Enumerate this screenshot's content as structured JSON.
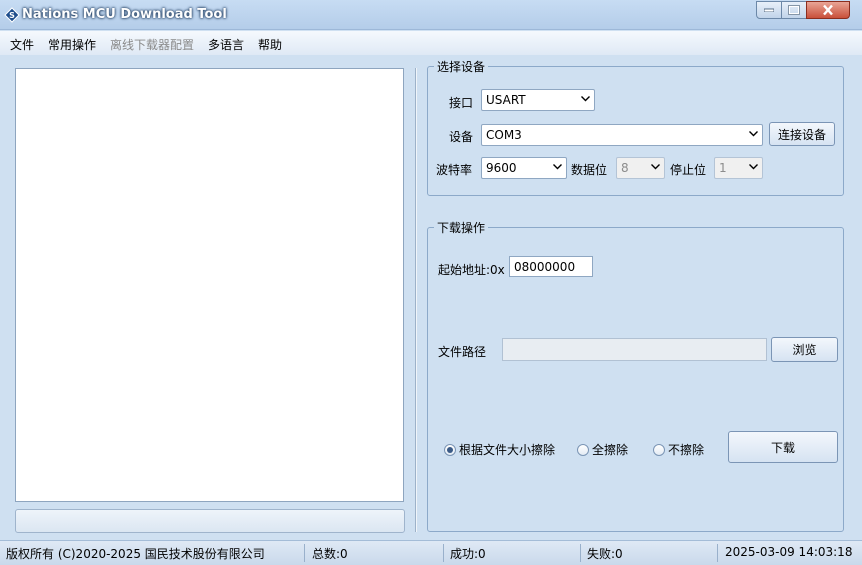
{
  "window": {
    "title": "Nations MCU Download Tool"
  },
  "menu": {
    "items": [
      {
        "label": "文件",
        "disabled": false
      },
      {
        "label": "常用操作",
        "disabled": false
      },
      {
        "label": "离线下载器配置",
        "disabled": true
      },
      {
        "label": "多语言",
        "disabled": false
      },
      {
        "label": "帮助",
        "disabled": false
      }
    ]
  },
  "device_group": {
    "title": "选择设备",
    "interface_label": "接口",
    "interface_value": "USART",
    "device_label": "设备",
    "device_value": "COM3",
    "connect_button": "连接设备",
    "baud_label": "波特率",
    "baud_value": "9600",
    "databits_label": "数据位",
    "databits_value": "8",
    "stopbits_label": "停止位",
    "stopbits_value": "1"
  },
  "download_group": {
    "title": "下载操作",
    "start_addr_label": "起始地址:0x",
    "start_addr_value": "08000000",
    "file_path_label": "文件路径",
    "file_path_value": "",
    "browse_button": "浏览",
    "erase_options": [
      {
        "label": "根据文件大小擦除",
        "checked": true
      },
      {
        "label": "全擦除",
        "checked": false
      },
      {
        "label": "不擦除",
        "checked": false
      }
    ],
    "download_button": "下载"
  },
  "statusbar": {
    "copyright": "版权所有 (C)2020-2025 国民技术股份有限公司",
    "total": "总数:0",
    "success": "成功:0",
    "failed": "失败:0",
    "datetime": "2025-03-09 14:03:18"
  }
}
